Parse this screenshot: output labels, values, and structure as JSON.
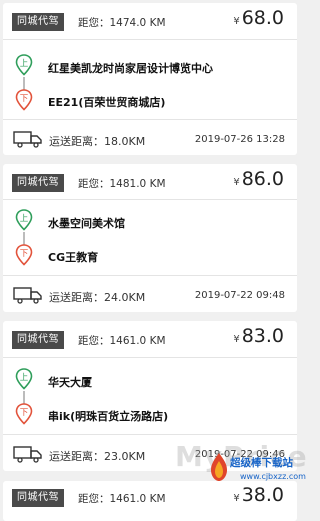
{
  "orders": [
    {
      "tag": "同城代驾",
      "distance_label": "距您：1474.0 KM",
      "currency": "¥",
      "price": "68.0",
      "pickup": "红星美凯龙时尚家居设计博览中心",
      "dropoff": "EE21(百荣世贸商城店)",
      "ship_label": "运送距离：18.0KM",
      "time": "2019-07-26 13:28"
    },
    {
      "tag": "同城代驾",
      "distance_label": "距您：1481.0 KM",
      "currency": "¥",
      "price": "86.0",
      "pickup": "水墨空间美术馆",
      "dropoff": "CG王教育",
      "ship_label": "运送距离：24.0KM",
      "time": "2019-07-22 09:48"
    },
    {
      "tag": "同城代驾",
      "distance_label": "距您：1461.0 KM",
      "currency": "¥",
      "price": "83.0",
      "pickup": "华天大厦",
      "dropoff": "串ik(明珠百货立汤路店)",
      "ship_label": "运送距离：23.0KM",
      "time": "2019-07-22 09:46"
    },
    {
      "tag": "同城代驾",
      "distance_label": "距您：1461.0 KM",
      "currency": "¥",
      "price": "38.0"
    }
  ],
  "icons": {
    "pickup": "pickup-pin-icon",
    "dropoff": "dropoff-pin-icon",
    "truck": "truck-icon"
  },
  "colors": {
    "pickup_green": "#2f9e5b",
    "dropoff_red": "#e2533b",
    "tag_bg": "#4a4a4a"
  },
  "watermark": {
    "ghost": "MyPrice",
    "brand": "超级棒下载站",
    "site": "www.cjbxzz.com"
  }
}
